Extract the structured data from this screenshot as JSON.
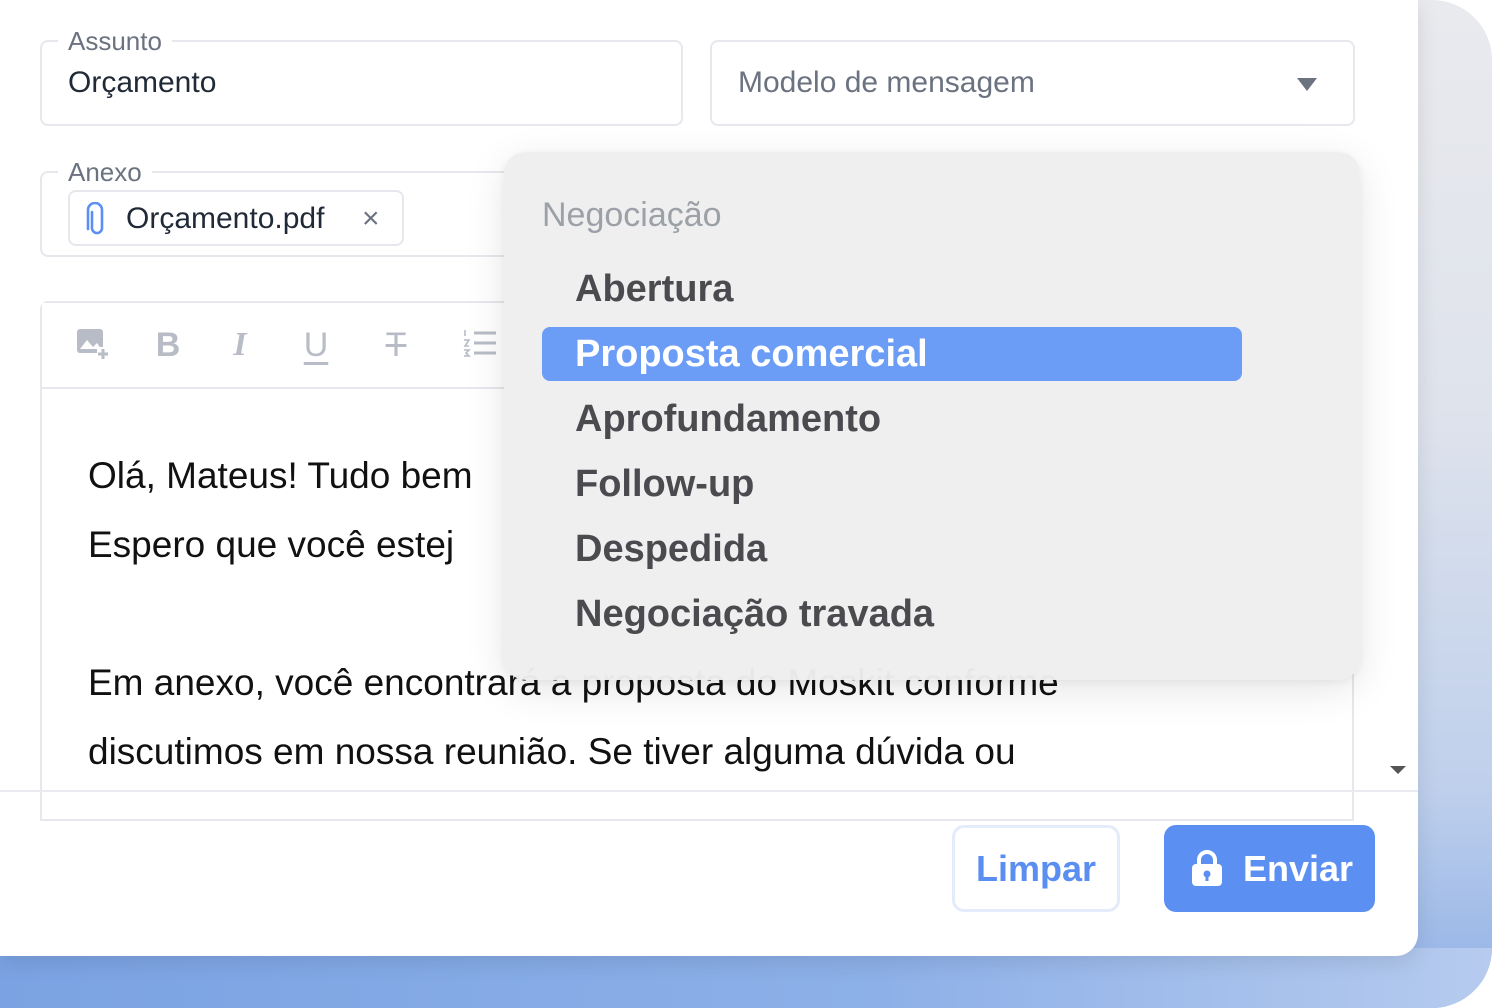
{
  "subject": {
    "label": "Assunto",
    "value": "Orçamento"
  },
  "template": {
    "placeholder": "Modelo de mensagem"
  },
  "attachment": {
    "label": "Anexo",
    "file_name": "Orçamento.pdf",
    "remove_glyph": "×"
  },
  "toolbar": {
    "image_icon": "image-add-icon",
    "bold_glyph": "B",
    "italic_glyph": "I",
    "underline_glyph": "U",
    "strike_glyph": "T",
    "list_icon": "numbered-list-icon"
  },
  "editor": {
    "lines": [
      "Olá, Mateus! Tudo bem",
      "Espero que você estej",
      "Em anexo, você encontrará a proposta do Moskit conforme",
      "discutimos em nossa reunião. Se tiver alguma dúvida ou"
    ]
  },
  "dropdown": {
    "group_label": "Negociação",
    "items": [
      {
        "label": "Abertura",
        "selected": false
      },
      {
        "label": "Proposta comercial",
        "selected": true
      },
      {
        "label": "Aprofundamento",
        "selected": false
      },
      {
        "label": "Follow-up",
        "selected": false
      },
      {
        "label": "Despedida",
        "selected": false
      },
      {
        "label": "Negociação travada",
        "selected": false
      }
    ]
  },
  "actions": {
    "clear_label": "Limpar",
    "send_label": "Enviar",
    "send_icon": "lock-icon"
  },
  "colors": {
    "accent": "#5b8ff2",
    "selected_item": "#6b9cf6",
    "clear_text": "#5a8ef0",
    "border": "#e6e8ee"
  }
}
